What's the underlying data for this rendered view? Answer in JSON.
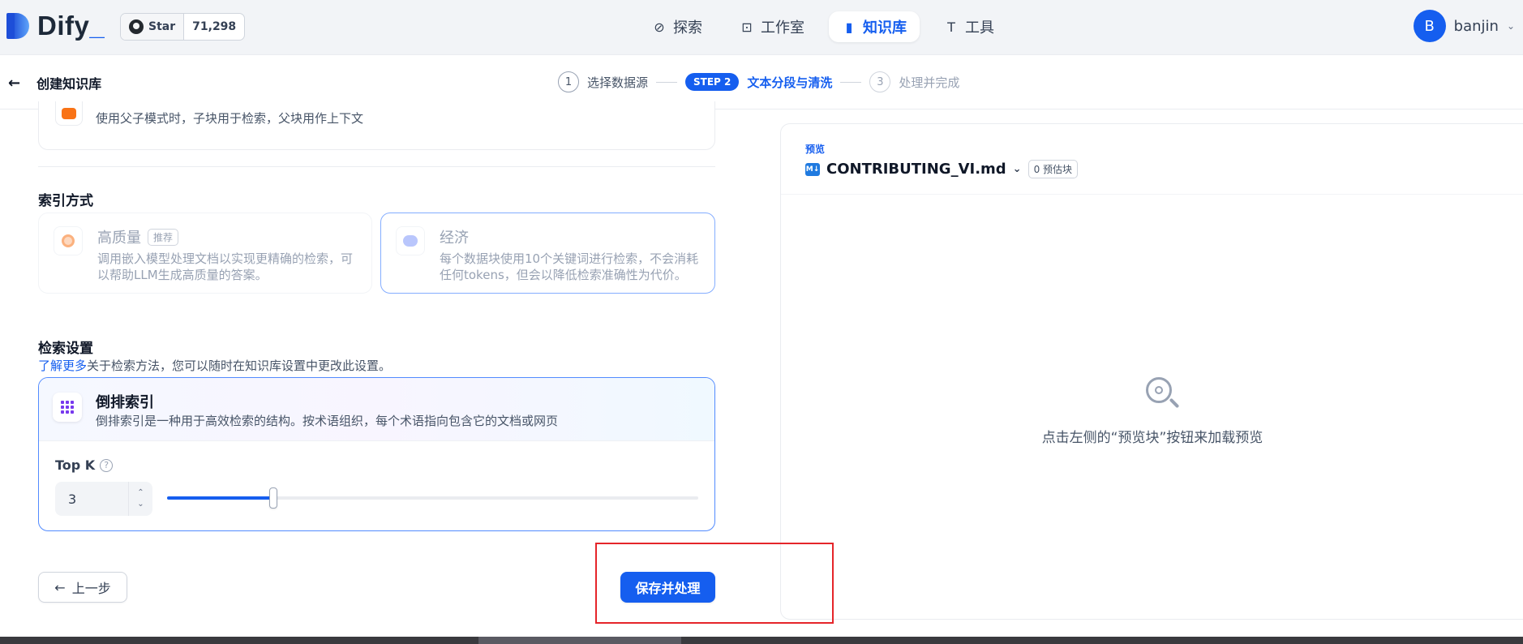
{
  "app": {
    "logo_text": "Dify",
    "github": {
      "star_label": "Star",
      "count": "71,298"
    }
  },
  "nav": {
    "tabs": [
      {
        "label": "探索",
        "icon": "compass-icon",
        "active": false
      },
      {
        "label": "工作室",
        "icon": "robot-icon",
        "active": false
      },
      {
        "label": "知识库",
        "icon": "book-icon",
        "active": true
      },
      {
        "label": "工具",
        "icon": "hammer-icon",
        "active": false
      }
    ],
    "user": {
      "initial": "B",
      "name": "banjin"
    }
  },
  "subheader": {
    "back_label": "创建知识库",
    "steps": [
      {
        "num": "1",
        "label": "选择数据源",
        "state": "done"
      },
      {
        "num": "STEP 2",
        "label": "文本分段与清洗",
        "state": "active"
      },
      {
        "num": "3",
        "label": "处理并完成",
        "state": "todo"
      }
    ]
  },
  "segmentation": {
    "parent_child_desc": "使用父子模式时，子块用于检索，父块用作上下文"
  },
  "index_method": {
    "title": "索引方式",
    "options": [
      {
        "title": "高质量",
        "tag": "推荐",
        "desc": "调用嵌入模型处理文档以实现更精确的检索，可以帮助LLM生成高质量的答案。",
        "selected": false
      },
      {
        "title": "经济",
        "tag": "",
        "desc": "每个数据块使用10个关键词进行检索，不会消耗任何tokens，但会以降低检索准确性为代价。",
        "selected": true
      }
    ]
  },
  "retrieval": {
    "title": "检索设置",
    "help_link": "了解更多",
    "help_text": "关于检索方法，您可以随时在知识库设置中更改此设置。",
    "inverted_index": {
      "title": "倒排索引",
      "desc": "倒排索引是一种用于高效检索的结构。按术语组织，每个术语指向包含它的文档或网页"
    },
    "top_k": {
      "label": "Top K",
      "value": "3",
      "slider_fraction": 0.2
    }
  },
  "actions": {
    "prev_label": "上一步",
    "save_label": "保存并处理"
  },
  "preview": {
    "label": "预览",
    "file_name": "CONTRIBUTING_VI.md",
    "badge": "0 预估块",
    "empty_text": "点击左侧的“预览块”按钮来加载预览"
  },
  "colors": {
    "accent": "#155eef",
    "highlight_box": "#e5252a"
  }
}
